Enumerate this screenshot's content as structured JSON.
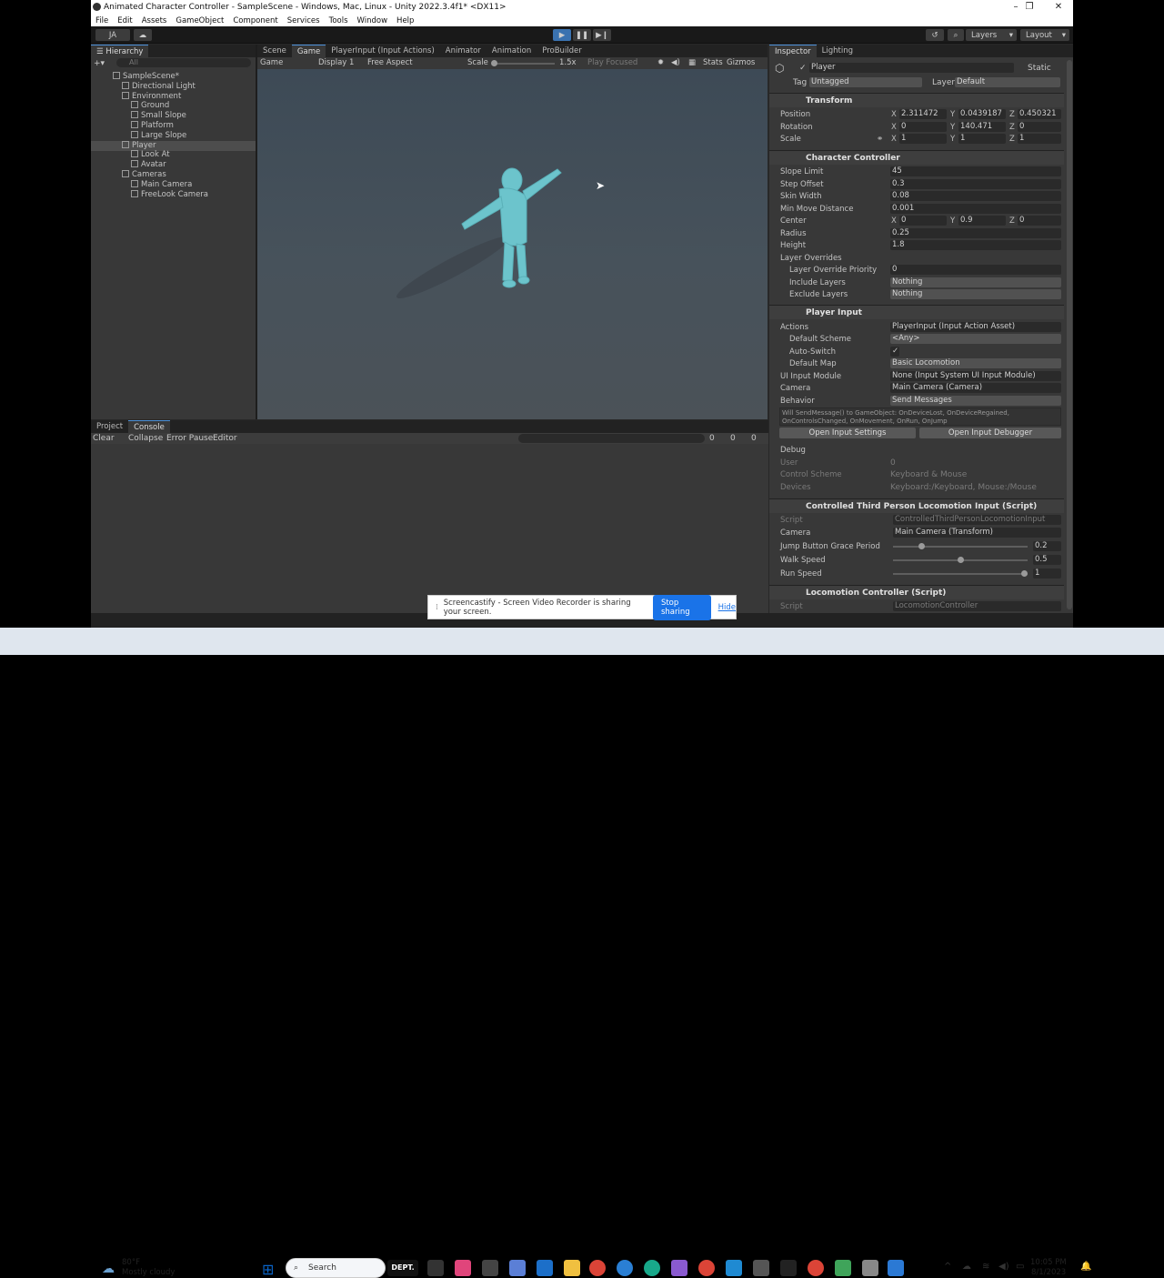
{
  "window": {
    "title": "Animated Character Controller - SampleScene - Windows, Mac, Linux - Unity 2022.3.4f1* <DX11>",
    "minimize": "–",
    "maximize": "❐",
    "close": "✕"
  },
  "menu": [
    "File",
    "Edit",
    "Assets",
    "GameObject",
    "Component",
    "Services",
    "Tools",
    "Window",
    "Help"
  ],
  "toolbar": {
    "account": "JA",
    "layers": "Layers",
    "layout": "Layout"
  },
  "hierarchy": {
    "tab": "Hierarchy",
    "search_placeholder": "All",
    "items": [
      {
        "label": "SampleScene*",
        "depth": 0
      },
      {
        "label": "Directional Light",
        "depth": 1
      },
      {
        "label": "Environment",
        "depth": 1
      },
      {
        "label": "Ground",
        "depth": 2
      },
      {
        "label": "Small Slope",
        "depth": 2
      },
      {
        "label": "Platform",
        "depth": 2
      },
      {
        "label": "Large Slope",
        "depth": 2
      },
      {
        "label": "Player",
        "depth": 1
      },
      {
        "label": "Look At",
        "depth": 2
      },
      {
        "label": "Avatar",
        "depth": 2
      },
      {
        "label": "Cameras",
        "depth": 1
      },
      {
        "label": "Main Camera",
        "depth": 2
      },
      {
        "label": "FreeLook Camera",
        "depth": 2
      }
    ]
  },
  "center_tabs": [
    "Scene",
    "Game",
    "PlayerInput (Input Actions)",
    "Animator",
    "Animation",
    "ProBuilder"
  ],
  "game_toolbar": {
    "mode": "Game",
    "display": "Display 1",
    "aspect": "Free Aspect",
    "scale_label": "Scale",
    "scale_value": "1.5x",
    "play_focused": "Play Focused",
    "stats": "Stats",
    "gizmos": "Gizmos"
  },
  "console": {
    "tabs": [
      "Project",
      "Console"
    ],
    "buttons": [
      "Clear",
      "Collapse",
      "Error Pause",
      "Editor"
    ],
    "counts": [
      "0",
      "0",
      "0"
    ]
  },
  "inspector": {
    "tabs": [
      "Inspector",
      "Lighting"
    ],
    "object_name": "Player",
    "static_label": "Static",
    "tag_label": "Tag",
    "tag_value": "Untagged",
    "layer_label": "Layer",
    "layer_value": "Default",
    "transform": {
      "title": "Transform",
      "position": {
        "label": "Position",
        "x": "2.311472",
        "y": "0.0439187",
        "z": "0.450321"
      },
      "rotation": {
        "label": "Rotation",
        "x": "0",
        "y": "140.471",
        "z": "0"
      },
      "scale": {
        "label": "Scale",
        "x": "1",
        "y": "1",
        "z": "1"
      }
    },
    "character_controller": {
      "title": "Character Controller",
      "slope_limit": {
        "label": "Slope Limit",
        "value": "45"
      },
      "step_offset": {
        "label": "Step Offset",
        "value": "0.3"
      },
      "skin_width": {
        "label": "Skin Width",
        "value": "0.08"
      },
      "min_move": {
        "label": "Min Move Distance",
        "value": "0.001"
      },
      "center": {
        "label": "Center",
        "x": "0",
        "y": "0.9",
        "z": "0"
      },
      "radius": {
        "label": "Radius",
        "value": "0.25"
      },
      "height": {
        "label": "Height",
        "value": "1.8"
      },
      "layer_overrides": "Layer Overrides",
      "override_priority": {
        "label": "Layer Override Priority",
        "value": "0"
      },
      "include_layers": {
        "label": "Include Layers",
        "value": "Nothing"
      },
      "exclude_layers": {
        "label": "Exclude Layers",
        "value": "Nothing"
      }
    },
    "player_input": {
      "title": "Player Input",
      "actions": {
        "label": "Actions",
        "value": "PlayerInput (Input Action Asset)"
      },
      "default_scheme": {
        "label": "Default Scheme",
        "value": "<Any>"
      },
      "auto_switch": {
        "label": "Auto-Switch",
        "value": "✓"
      },
      "default_map": {
        "label": "Default Map",
        "value": "Basic Locomotion"
      },
      "ui_input_module": {
        "label": "UI Input Module",
        "value": "None (Input System UI Input Module)"
      },
      "camera": {
        "label": "Camera",
        "value": "Main Camera (Camera)"
      },
      "behavior": {
        "label": "Behavior",
        "value": "Send Messages"
      },
      "info": "Will SendMessage() to GameObject: OnDeviceLost, OnDeviceRegained, OnControlsChanged, OnMovement, OnRun, OnJump",
      "open_settings": "Open Input Settings",
      "open_debugger": "Open Input Debugger",
      "debug": "Debug",
      "user": {
        "label": "User",
        "value": "0"
      },
      "control_scheme": {
        "label": "Control Scheme",
        "value": "Keyboard & Mouse"
      },
      "devices": {
        "label": "Devices",
        "value": "Keyboard:/Keyboard, Mouse:/Mouse"
      }
    },
    "ctpli": {
      "title": "Controlled Third Person Locomotion Input (Script)",
      "script": {
        "label": "Script",
        "value": "ControlledThirdPersonLocomotionInput"
      },
      "camera": {
        "label": "Camera",
        "value": "Main Camera (Transform)"
      },
      "jump_grace": {
        "label": "Jump Button Grace Period",
        "value": "0.2",
        "fraction": 0.2
      },
      "walk_speed": {
        "label": "Walk Speed",
        "value": "0.5",
        "fraction": 0.5
      },
      "run_speed": {
        "label": "Run Speed",
        "value": "1",
        "fraction": 1.0
      }
    },
    "locomotion": {
      "title": "Locomotion Controller (Script)",
      "script": {
        "label": "Script",
        "value": "LocomotionController"
      }
    }
  },
  "share_bar": {
    "text": "Screencastify - Screen Video Recorder is sharing your screen.",
    "stop": "Stop sharing",
    "hide": "Hide"
  },
  "taskbar": {
    "weather_temp": "80°F",
    "weather_desc": "Mostly cloudy",
    "search": "Search",
    "time": "10:05 PM",
    "date": "8/1/2023"
  }
}
